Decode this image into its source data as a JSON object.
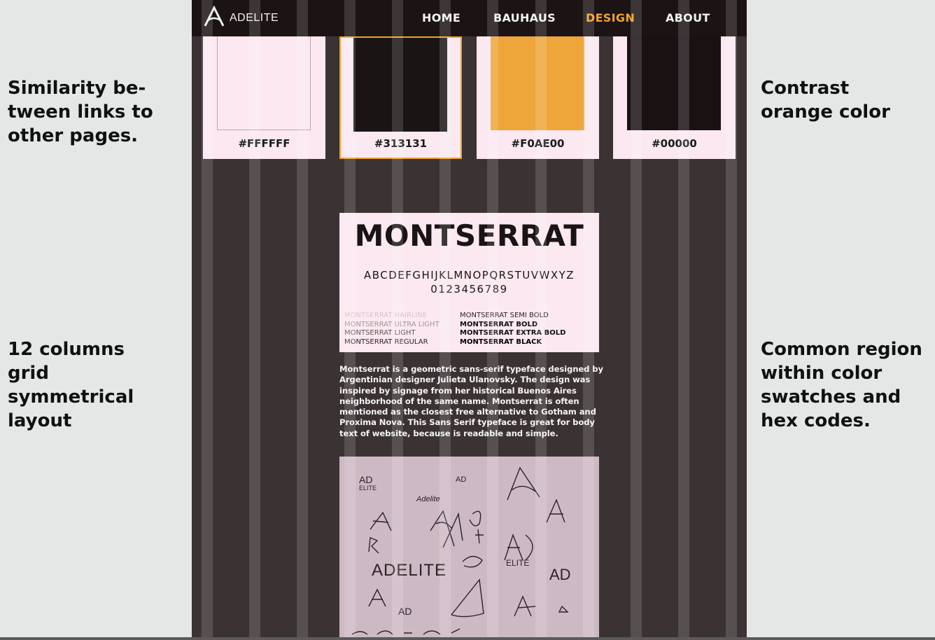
{
  "annotations": {
    "top_left": "Similarity be-\ntween links to\nother pages.",
    "bottom_left": "12 columns\ngrid\nsymmetrical\nlayout",
    "top_right": "Contrast\norange color",
    "bottom_right": "Common region\nwithin color\nswatches and\nhex codes."
  },
  "nav": {
    "logo_text": "ADELITE",
    "items": [
      {
        "label": "HOME",
        "color": "#f2f2f2"
      },
      {
        "label": "BAUHAUS",
        "color": "#f2f2f2"
      },
      {
        "label": "DESIGN",
        "color": "#f0a229",
        "active": true
      },
      {
        "label": "ABOUT",
        "color": "#f2f2f2"
      }
    ]
  },
  "swatches": [
    {
      "label": "#FFFFFF",
      "color": "#fbe8f0"
    },
    {
      "label": "#313131",
      "color": "#1a1414",
      "highlighted": true
    },
    {
      "label": "#F0AE00",
      "color": "#eea53a"
    },
    {
      "label": "#00000",
      "color": "#1a1113"
    }
  ],
  "typeface": {
    "name": "MONTSERRAT",
    "alphabet": "ABCDEFGHIJKLMNOPQRSTUVWXYZ",
    "digits": "0123456789",
    "weights_left": [
      "MONTSERRAT HAIRLINE",
      "MONTSERRAT ULTRA LIGHT",
      "MONTSERRAT LIGHT",
      "MONTSERRAT REGULAR"
    ],
    "weights_right": [
      "MONTSERRAT SEMI BOLD",
      "MONTSERRAT BOLD",
      "MONTSERRAT EXTRA BOLD",
      "MONTSERRAT BLACK"
    ]
  },
  "description": "Montserrat is a geometric sans-serif typeface designed by Argentinian designer Julieta Ulanovsky. The design was inspired by signage from her historical Buenos Aires neighborhood of the same name. Montserrat is often mentioned as the closest free alternative to Gotham and Proxima Nova. This Sans Serif typeface is great for body text of website, because is readable and simple.",
  "sketch": {
    "words": [
      "AD",
      "ELITE",
      "Adelite",
      "ADELITE",
      "ELITE",
      "AD",
      "AD",
      "AD",
      "ADELITE"
    ]
  },
  "colors": {
    "accent": "#f0a229",
    "page_bg": "#3a3233",
    "nav_bg": "#1b1314"
  }
}
